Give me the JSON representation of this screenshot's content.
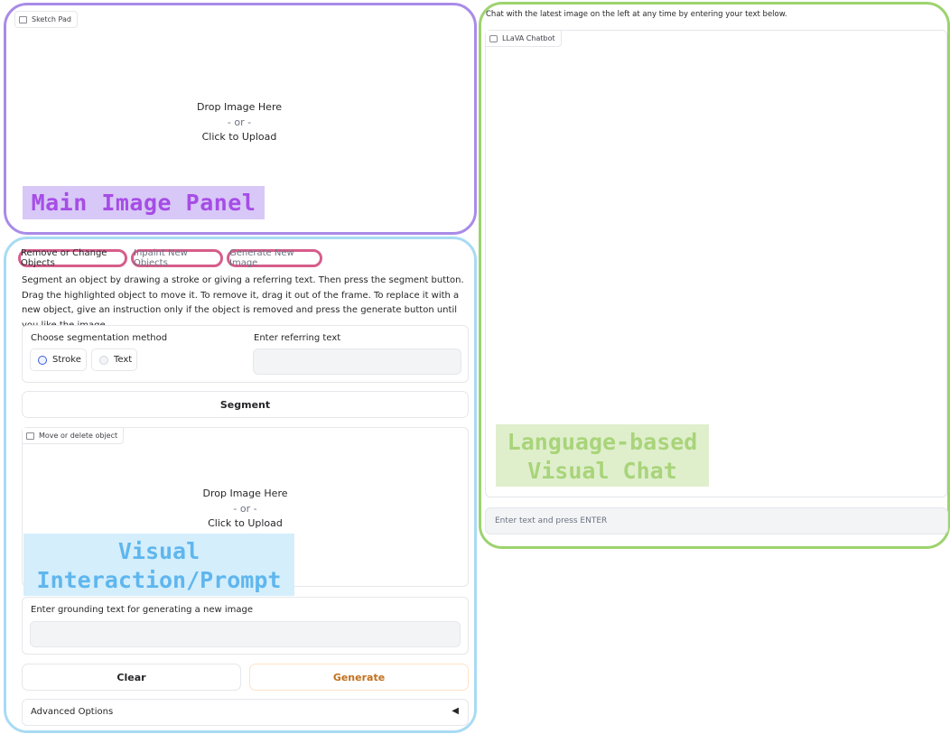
{
  "sketch_pad": {
    "label": "Sketch Pad",
    "drop_line1": "Drop Image Here",
    "drop_or": "- or -",
    "drop_line2": "Click to Upload"
  },
  "annotations": {
    "main_panel": "Main Image Panel",
    "visual_line1": "Visual",
    "visual_line2": "Interaction/Prompt",
    "chat_line1": "Language-based",
    "chat_line2": "Visual Chat"
  },
  "tabs": [
    "Remove or Change Objects",
    "Inpaint New Objects",
    "Generate New Image"
  ],
  "description": "Segment an object by drawing a stroke or giving a referring text. Then press the segment button. Drag the highlighted object to move it. To remove it, drag it out of the frame. To replace it with a new object, give an instruction only if the object is removed and press the generate button until you like the image.",
  "segmentation": {
    "method_label": "Choose segmentation method",
    "options": [
      "Stroke",
      "Text"
    ],
    "selected": "Stroke",
    "referring_label": "Enter referring text",
    "referring_value": ""
  },
  "segment_button": "Segment",
  "move_panel": {
    "label": "Move or delete object",
    "drop_line1": "Drop Image Here",
    "drop_or": "- or -",
    "drop_line2": "Click to Upload"
  },
  "grounding": {
    "label": "Enter grounding text for generating a new image",
    "value": ""
  },
  "clear_button": "Clear",
  "generate_button": "Generate",
  "advanced": {
    "label": "Advanced Options",
    "arrow": "◀"
  },
  "chat": {
    "intro": "Chat with the latest image on the left at any time by entering your text below.",
    "chatbot_label": "LLaVA Chatbot",
    "input_placeholder": "Enter text and press ENTER"
  },
  "colors": {
    "main_outline": "#a98be8",
    "visual_outline": "#a8dbf3",
    "chat_outline": "#9dd36e",
    "tab_outline": "#d65d8b",
    "main_label_bg": "#d8c8f7",
    "main_label_text": "#a64de6",
    "visual_label_bg": "#d4eefc",
    "visual_label_text": "#5fb6ee",
    "chat_label_bg": "#dfefcc",
    "chat_label_text": "#a9d47a",
    "generate_text": "#c2701f"
  }
}
